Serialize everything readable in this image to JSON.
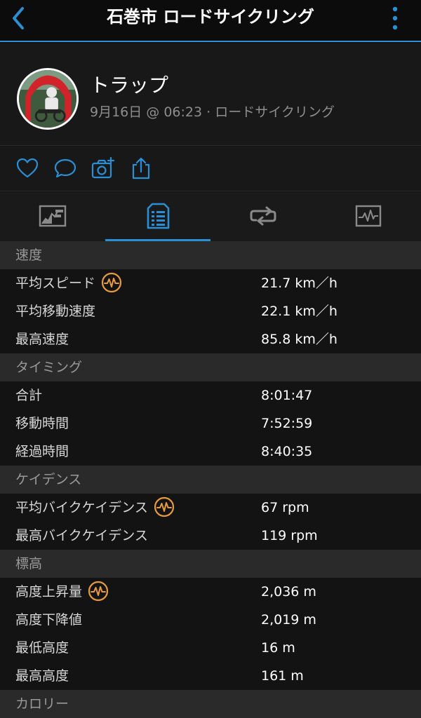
{
  "header": {
    "title": "石巻市 ロードサイクリング"
  },
  "activity": {
    "name": "トラップ",
    "subtitle": "9月16日 @ 06:23 · ロードサイクリング"
  },
  "colors": {
    "accent": "#2b8fd6",
    "badge": "#e89a3c",
    "section_bg": "#2a2a2a"
  },
  "actions": [
    "heart-icon",
    "comment-icon",
    "add-photo-icon",
    "share-icon"
  ],
  "tabs": [
    "map-chart-tab",
    "stats-list-tab",
    "laps-tab",
    "graphs-tab"
  ],
  "active_tab": "stats-list-tab",
  "sections": [
    {
      "title": "速度",
      "rows": [
        {
          "label": "平均スピード",
          "value": "21.7 km／h",
          "badge": true
        },
        {
          "label": "平均移動速度",
          "value": "22.1 km／h"
        },
        {
          "label": "最高速度",
          "value": "85.8 km／h"
        }
      ]
    },
    {
      "title": "タイミング",
      "rows": [
        {
          "label": "合計",
          "value": "8:01:47"
        },
        {
          "label": "移動時間",
          "value": "7:52:59"
        },
        {
          "label": "経過時間",
          "value": "8:40:35"
        }
      ]
    },
    {
      "title": "ケイデンス",
      "rows": [
        {
          "label": "平均バイクケイデンス",
          "value": "67 rpm",
          "badge": true
        },
        {
          "label": "最高バイクケイデンス",
          "value": "119 rpm"
        }
      ]
    },
    {
      "title": "標高",
      "rows": [
        {
          "label": "高度上昇量",
          "value": "2,036 m",
          "badge": true
        },
        {
          "label": "高度下降値",
          "value": "2,019 m"
        },
        {
          "label": "最低高度",
          "value": "16 m"
        },
        {
          "label": "最高高度",
          "value": "161 m"
        }
      ]
    },
    {
      "title": "カロリー",
      "rows": []
    }
  ]
}
